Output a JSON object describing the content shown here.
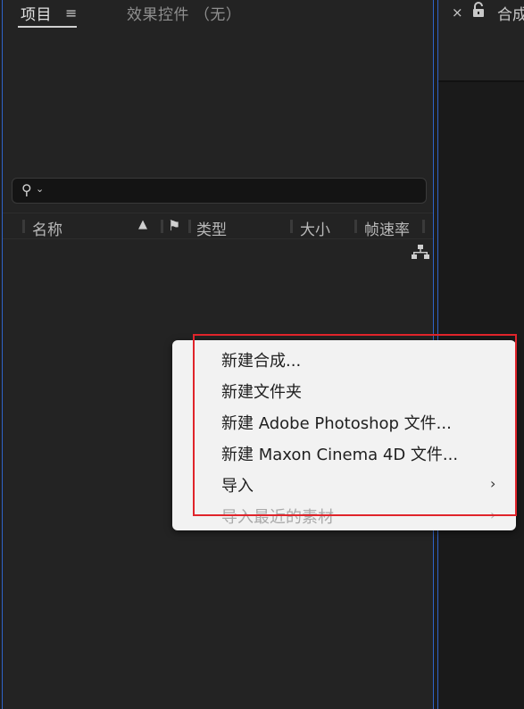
{
  "project_panel": {
    "tab_project": "项目",
    "tab_menu_icon": "hamburger-icon",
    "tab_effects": "效果控件 （无）",
    "search": {
      "placeholder": "",
      "icon": "search-icon"
    },
    "columns": {
      "name": "名称",
      "type": "类型",
      "size": "大小",
      "framerate": "帧速率"
    }
  },
  "comp_panel": {
    "close_glyph": "×",
    "title": "合成"
  },
  "context_menu": {
    "items": [
      {
        "label": "新建合成...",
        "disabled": false,
        "submenu": false
      },
      {
        "label": "新建文件夹",
        "disabled": false,
        "submenu": false
      },
      {
        "label": "新建 Adobe Photoshop 文件...",
        "disabled": false,
        "submenu": false
      },
      {
        "label": "新建 Maxon Cinema 4D 文件...",
        "disabled": false,
        "submenu": false
      },
      {
        "label": "导入",
        "disabled": false,
        "submenu": true
      },
      {
        "label": "导入最近的素材",
        "disabled": true,
        "submenu": true
      }
    ]
  },
  "colors": {
    "panel_border": "#2f63c9",
    "highlight_border": "#e0242b",
    "menu_bg": "#f2f2f2"
  }
}
